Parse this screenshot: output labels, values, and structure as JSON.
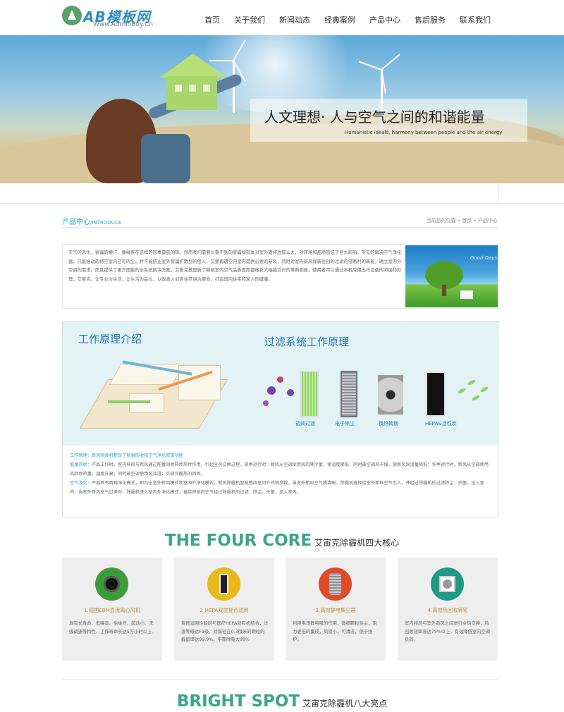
{
  "header": {
    "logo_text": "AB模板网",
    "logo_sub": "Www.AdminBuy.Cn",
    "nav": [
      "首页",
      "关于我们",
      "新闻动态",
      "经典案例",
      "产品中心",
      "售后服务",
      "联系我们"
    ]
  },
  "banner": {
    "title_cn": "人文理想· 人与空气之间的和谐能量",
    "title_en": "Humanistic ideals, harmony between people and the air energy"
  },
  "section": {
    "title": "产品中心",
    "title_en": "/INTRODUCE",
    "breadcrumb": "当前您的位置 » 首页 » 产品中心"
  },
  "intro": {
    "text": "天气的恶化，雾霾的横行，像绳索在这样的回事蔓延的铸。然而我们需要以重不到的雾霾却有体对室外面排放那么大，对环境和品质造成了巨大影响。常见的解决空气净化器，只能被动的将空室内已有的尘，并不能防止室外雾霾扩散到的侵入，又要再遇空内室内提供必要的新风，同时对室内新风保新密封的过滤的侵略利的新能。确立室内外空调的需求。而且提供了更方面能的全系统解决方案，艾宙克搭配新了新颖室内空气品质度而都做新大幅能活行的事新刷新。使用者可以通过本机应用出行设备的添加和处理，艾宙克，让专业为生活，让生活为品位，以改善人们居住环境为使命，打造国内住宅和家人的健康。",
    "image_caption": "Good Days"
  },
  "works": {
    "heading_left": "工作原理介绍",
    "heading_right": "过滤系统工作原理",
    "filter_labels": [
      "初效过滤",
      "电子除尘",
      "换热转换",
      "HEPA&活性炭"
    ],
    "body_title": "工作原理：新风除霾机整合了能量回收和空气净化双重功能",
    "body_p1_label": "能量回收：",
    "body_p1": "产品工作时，室内排风与新风通过能量回收热传热传作用，引起全热交换过程，夏季运行时，新风从空调使用风的降冷量，使温度降低，同时被空调风干燥，使新风含湿量降低；冬季运行时，新风从空调使用风回收热量，温度升高，同时被空调使用风加湿，实现冷暖热的回收。",
    "body_p2_label": "空气净化：",
    "body_p2": "产品具有两种净化模式，即为全室外新风模式和室内外净化模式，新风除霾机智能感应室内外环境参数，当室外新风空气质清晰，除霾机选择度室外新鲜空气引入，并经过除霾机的过滤除尘、杀菌，送入室内；当室外新风空气过差时，除霾机进入室内外净化模式，直接将室内空气经过除霾机的过滤、除尘、杀菌，送入室内。"
  },
  "four_core": {
    "title_en": "THE FOUR CORE",
    "title_cn": "艾宙克除霾机四大核心",
    "cards": [
      {
        "icon": "motor-icon",
        "color": "#3f9a3c",
        "title": "1.德国EBM直流离心风机",
        "text": "具有长寿命、低噪音、免维修、超动小、无级调速等特性，工作寿命长达5万小时以上。"
      },
      {
        "icon": "filter-icon",
        "color": "#e9b81a",
        "title": "2.HEPA双层复合滤网",
        "text": "将预滤网性能层与医疗HEPA层有机结合，过滤等级达F9级，对直径在0.3微米的颗粒的截留率达99.9%，牢靠除吸大99%"
      },
      {
        "icon": "cylinder-icon",
        "color": "#e04a2a",
        "title": "3.高效静电集尘器",
        "text": "利用电场静电吸的作用，微细颗粒除尘，阻力更低的集成，风阻小，可清洗，便于维护。"
      },
      {
        "icon": "fan-icon",
        "color": "#1f9a86",
        "title": "4.高效热回收转轮",
        "text": "室内排风与室外新风之间进行全热交换，热回收效率高达75%以上，有效降低室内空调负荷。"
      }
    ]
  },
  "bright_spot": {
    "title_en": "BRIGHT SPOT",
    "title_cn": "艾宙克除霾机八大亮点"
  }
}
